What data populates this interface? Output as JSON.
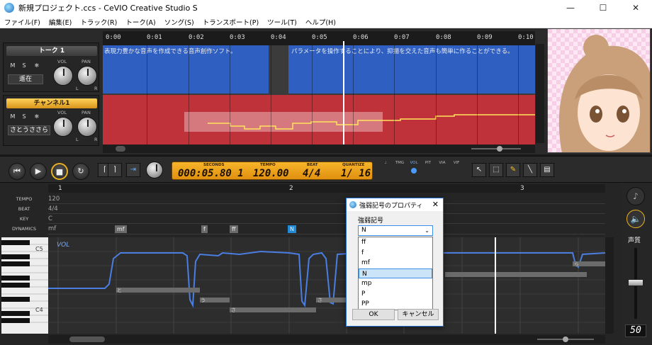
{
  "window": {
    "title": "新規プロジェクト.ccs - CeVIO Creative Studio S",
    "min": "—",
    "max": "☐",
    "close": "✕"
  },
  "menu": [
    "ファイル(F)",
    "編集(E)",
    "トラック(R)",
    "トーク(A)",
    "ソング(S)",
    "トランスポート(P)",
    "ツール(T)",
    "ヘルプ(H)"
  ],
  "tracks": {
    "talk": {
      "name": "トーク 1",
      "m": "M",
      "s": "S",
      "cast": "遥在",
      "vol": "VOL",
      "pan": "PAN",
      "l": "L",
      "r": "R"
    },
    "song": {
      "name": "チャンネル1",
      "m": "M",
      "s": "S",
      "cast": "さとうささら",
      "vol": "VOL",
      "pan": "PAN",
      "l": "L",
      "r": "R"
    }
  },
  "timeline": {
    "ticks": [
      "0:00",
      "0:01",
      "0:02",
      "0:03",
      "0:04",
      "0:05",
      "0:06",
      "0:07",
      "0:08",
      "0:09",
      "0:10"
    ],
    "talk_text_1": "表現力豊かな音声を作成できる音声創作ソフト。",
    "talk_text_2": "パラメータを操作することにより、抑揚を交えた音声も簡単に作ることができる。"
  },
  "transport": {
    "labels": {
      "seconds": "SECONDS",
      "tempo": "TEMPO",
      "beat": "BEAT",
      "quantize": "QUANTIZE"
    },
    "values": {
      "seconds": "000:05.80 1",
      "tempo": "120.00",
      "beat": "4/4",
      "quantize": "1/ 16"
    },
    "switches": [
      "TMG",
      "VOL",
      "PIT",
      "VIA",
      "VIF"
    ]
  },
  "editor": {
    "rows": {
      "tempo": "TEMPO",
      "beat": "BEAT",
      "key": "KEY",
      "dynamics": "DYNAMICS"
    },
    "values": {
      "tempo": "120",
      "beat": "4/4",
      "key": "C",
      "dynamics": "mf"
    },
    "measures": [
      "1",
      "2",
      "3"
    ],
    "dyn_marks": [
      "mf",
      "f",
      "ff",
      "N"
    ],
    "vol_label": "VOL",
    "octaves": [
      "C5",
      "C4"
    ],
    "note_lyrics": [
      "と",
      "う",
      "さ",
      "さ",
      "ら"
    ]
  },
  "right_panel": {
    "label": "声質",
    "value": "50"
  },
  "dialog": {
    "title": "強弱記号のプロパティ",
    "label": "強弱記号",
    "selected": "N",
    "options": [
      "ff",
      "f",
      "mf",
      "N",
      "mp",
      "P",
      "PP"
    ],
    "ok": "OK",
    "cancel": "キャンセル"
  },
  "colors": {
    "talk_lane": "#2f5fc0",
    "song_lane": "#c0323a",
    "lcd": "#f0a020",
    "accent": "#1f6fd6"
  }
}
